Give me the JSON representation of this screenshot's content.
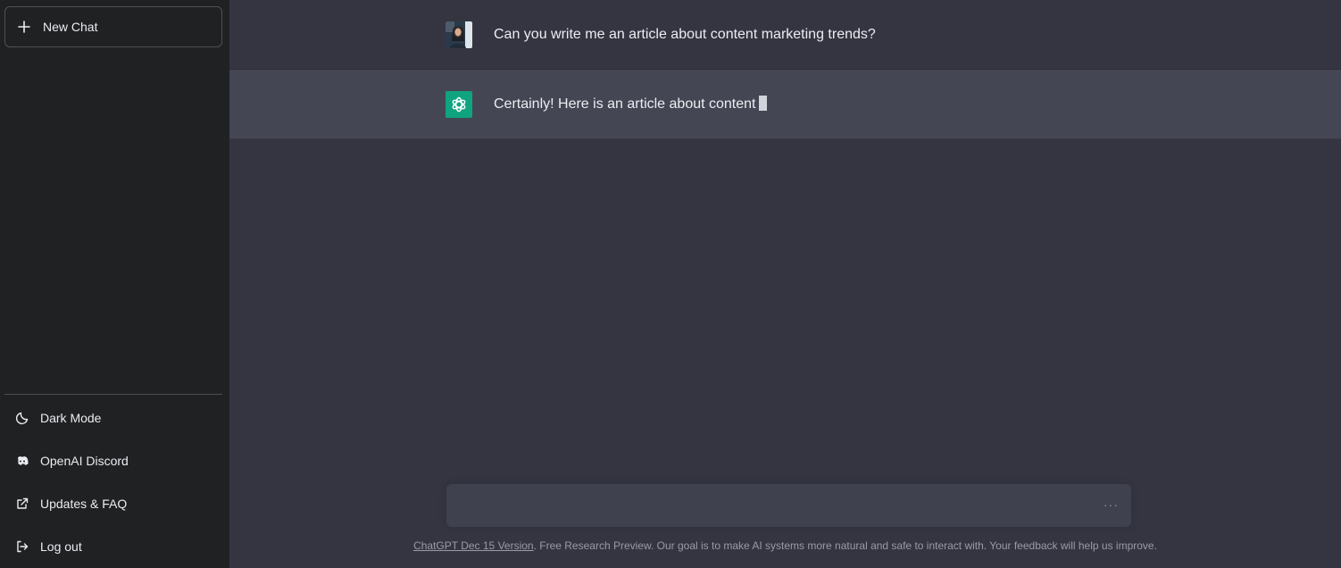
{
  "sidebar": {
    "new_chat": "New Chat",
    "items": [
      {
        "label": "Dark Mode",
        "icon": "moon-icon"
      },
      {
        "label": "OpenAI Discord",
        "icon": "discord-icon"
      },
      {
        "label": "Updates & FAQ",
        "icon": "external-link-icon"
      },
      {
        "label": "Log out",
        "icon": "logout-icon"
      }
    ]
  },
  "conversation": {
    "user_message": "Can you write me an article about content marketing trends?",
    "assistant_message": "Certainly! Here is an article about content"
  },
  "composer": {
    "value": "",
    "loading_indicator": "···"
  },
  "footer": {
    "version_link": "ChatGPT Dec 15 Version",
    "text": ". Free Research Preview. Our goal is to make AI systems more natural and safe to interact with. Your feedback will help us improve."
  },
  "colors": {
    "sidebar_bg": "#202123",
    "main_bg": "#343541",
    "assistant_row_bg": "#444654",
    "input_bg": "#40414f",
    "bot_avatar": "#10a37f"
  }
}
